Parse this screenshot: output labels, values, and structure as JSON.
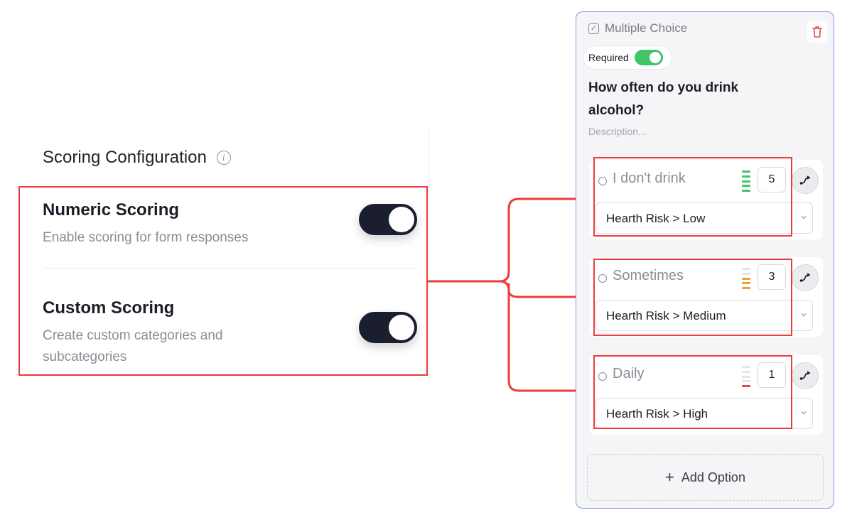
{
  "scoring": {
    "title": "Scoring Configuration",
    "numeric": {
      "title": "Numeric Scoring",
      "description": "Enable scoring for form responses",
      "enabled": true
    },
    "custom": {
      "title": "Custom Scoring",
      "description": "Create custom categories and subcategories",
      "enabled": true
    }
  },
  "question": {
    "type_label": "Multiple Choice",
    "required_label": "Required",
    "required": true,
    "text": "How often do you drink alcohol?",
    "description_placeholder": "Description...",
    "options": [
      {
        "label": "I don't drink",
        "score": "5",
        "category": "Hearth Risk > Low"
      },
      {
        "label": "Sometimes",
        "score": "3",
        "category": "Hearth Risk > Medium"
      },
      {
        "label": "Daily",
        "score": "1",
        "category": "Hearth Risk > High"
      }
    ],
    "add_option_label": "Add Option"
  },
  "colors": {
    "highlight": "#ee3b3b",
    "score_high": "#43c46a",
    "score_mid": "#e8a33a",
    "score_low": "#e5484d",
    "toggle_dark": "#1a1e2e",
    "card_border": "#7d98e6"
  }
}
